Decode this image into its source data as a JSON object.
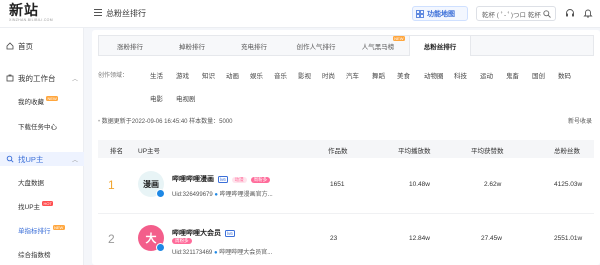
{
  "app": {
    "logo_text": "新站",
    "logo_sub": "XINZHAN.BILIBILI.COM",
    "page_title": "总粉丝排行",
    "func_button": "功能地图",
    "search_placeholder": "乾杯 ( ﾟ- ﾟ)つロ 乾杯"
  },
  "sidebar": {
    "home": "首页",
    "workspace": "我的工作台",
    "workspace_items": [
      {
        "label": "我的收藏",
        "badge": "NEW"
      },
      {
        "label": "下载任务中心",
        "badge": ""
      }
    ],
    "find_up": "找UP主",
    "find_up_items": [
      {
        "label": "大盘数据",
        "badge": ""
      },
      {
        "label": "找UP主",
        "badge": "HOT"
      },
      {
        "label": "单指标排行",
        "badge": "NEW"
      },
      {
        "label": "综合指数榜",
        "badge": ""
      }
    ]
  },
  "tabs": [
    {
      "label": "涨粉排行",
      "badge": ""
    },
    {
      "label": "掉粉排行",
      "badge": ""
    },
    {
      "label": "充电排行",
      "badge": ""
    },
    {
      "label": "创作人气排行",
      "badge": ""
    },
    {
      "label": "人气黑马榜",
      "badge": "NEW"
    },
    {
      "label": "总粉丝排行",
      "badge": ""
    }
  ],
  "active_tab": 5,
  "categories": {
    "label": "创作领域：",
    "row1": [
      "生活",
      "游戏",
      "知识",
      "动画",
      "娱乐",
      "音乐",
      "影视",
      "时尚",
      "汽车",
      "舞蹈",
      "美食",
      "动物圈",
      "科技",
      "运动",
      "鬼畜",
      "国创",
      "数码"
    ],
    "row2": [
      "电影",
      "电视剧"
    ]
  },
  "update_info": "数据更新于2022-09-06 16:45:40   样本数量：5000",
  "new_sign": "新号收录",
  "table": {
    "headers": [
      "排名",
      "UP主号",
      "作品数",
      "平均播放数",
      "平均获赞数",
      "总粉丝数"
    ],
    "rows": [
      {
        "rank": "1",
        "avatar_text": "漫画",
        "name": "哔哩哔哩漫画",
        "level": "lv6",
        "tags": [
          {
            "text": "动漫",
            "bg": "#ffe3ec",
            "fg": "#ff6b9a"
          },
          {
            "text": "周粉多",
            "bg": "#ff6b9a",
            "fg": "#fff"
          }
        ],
        "uid": "Uid:326499679",
        "official": "哔哩哔哩漫画官方...",
        "works": "1651",
        "avg_play": "10.48w",
        "avg_like": "2.62w",
        "fans": "4125.03w"
      },
      {
        "rank": "2",
        "avatar_text": "大",
        "name": "哔哩哔哩大会员",
        "level": "lv6",
        "tags": [
          {
            "text": "周粉多",
            "bg": "#ff6b9a",
            "fg": "#fff"
          }
        ],
        "uid": "Uid:321173469",
        "official": "哔哩哔哩大会员官...",
        "works": "23",
        "avg_play": "12.84w",
        "avg_like": "27.45w",
        "fans": "2551.01w"
      }
    ]
  },
  "colors": {
    "accent": "#3b6fd8",
    "rank1": "#f0a531",
    "rank2": "#999999",
    "pink": "#ff6b9a"
  }
}
